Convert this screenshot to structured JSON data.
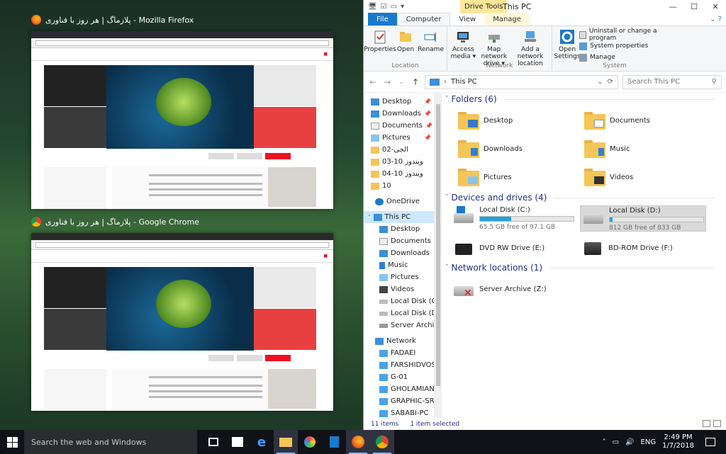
{
  "task_view": {
    "firefox": {
      "title": "پلازماگ | هر روز با فناوری - Mozilla Firefox"
    },
    "chrome": {
      "title": "پلازماگ | هر روز با فناوری - Google Chrome"
    }
  },
  "explorer": {
    "drive_tools_label": "Drive Tools",
    "window_title": "This PC",
    "ribbon_tabs": [
      "File",
      "Computer",
      "View",
      "Manage"
    ],
    "ribbon": {
      "location": {
        "label": "Location",
        "properties": "Properties",
        "open": "Open",
        "rename": "Rename"
      },
      "network": {
        "label": "Network",
        "access_media": "Access media ▾",
        "map_network_drive": "Map network drive ▾",
        "add_network_location": "Add a network location"
      },
      "system": {
        "label": "System",
        "open_settings": "Open Settings",
        "uninstall": "Uninstall or change a program",
        "system_properties": "System properties",
        "manage": "Manage"
      }
    },
    "address": {
      "path": "This PC",
      "search_placeholder": "Search This PC"
    },
    "nav_pane": {
      "quick_access": [
        {
          "label": "Desktop",
          "pinned": true
        },
        {
          "label": "Downloads",
          "pinned": true
        },
        {
          "label": "Documents",
          "pinned": true
        },
        {
          "label": "Pictures",
          "pinned": true
        },
        {
          "label": "02-الجی",
          "pinned": false
        },
        {
          "label": "03-10 ویندوز",
          "pinned": false
        },
        {
          "label": "04-10 ویندوز",
          "pinned": false
        },
        {
          "label": "10",
          "pinned": false
        }
      ],
      "onedrive": "OneDrive",
      "this_pc": "This PC",
      "this_pc_children": [
        "Desktop",
        "Documents",
        "Downloads",
        "Music",
        "Pictures",
        "Videos",
        "Local Disk (C:)",
        "Local Disk (D:)",
        "Server Archive (Z"
      ],
      "network": "Network",
      "network_children": [
        "FADAEI",
        "FARSHIDVOSOU",
        "G-01",
        "GHOLAMIAN",
        "GRAPHIC-SRV",
        "SABABI-PC"
      ]
    },
    "sections": {
      "folders": "Folders (6)",
      "devices": "Devices and drives (4)",
      "network_locations": "Network locations (1)"
    },
    "folders": [
      "Desktop",
      "Documents",
      "Downloads",
      "Music",
      "Pictures",
      "Videos"
    ],
    "drives": {
      "c": {
        "name": "Local Disk (C:)",
        "free": "65.5 GB free of 97.1 GB",
        "used_fraction": 0.33
      },
      "d": {
        "name": "Local Disk (D:)",
        "free": "812 GB free of 833 GB",
        "used_fraction": 0.03
      },
      "e": {
        "name": "DVD RW Drive (E:)"
      },
      "f": {
        "name": "BD-ROM Drive (F:)"
      }
    },
    "network_location": "Server Archive (Z:)",
    "status": {
      "items": "11 items",
      "selected": "1 item selected"
    }
  },
  "taskbar": {
    "search_placeholder": "Search the web and Windows",
    "language": "ENG",
    "time": "2:49 PM",
    "date": "1/7/2018"
  }
}
